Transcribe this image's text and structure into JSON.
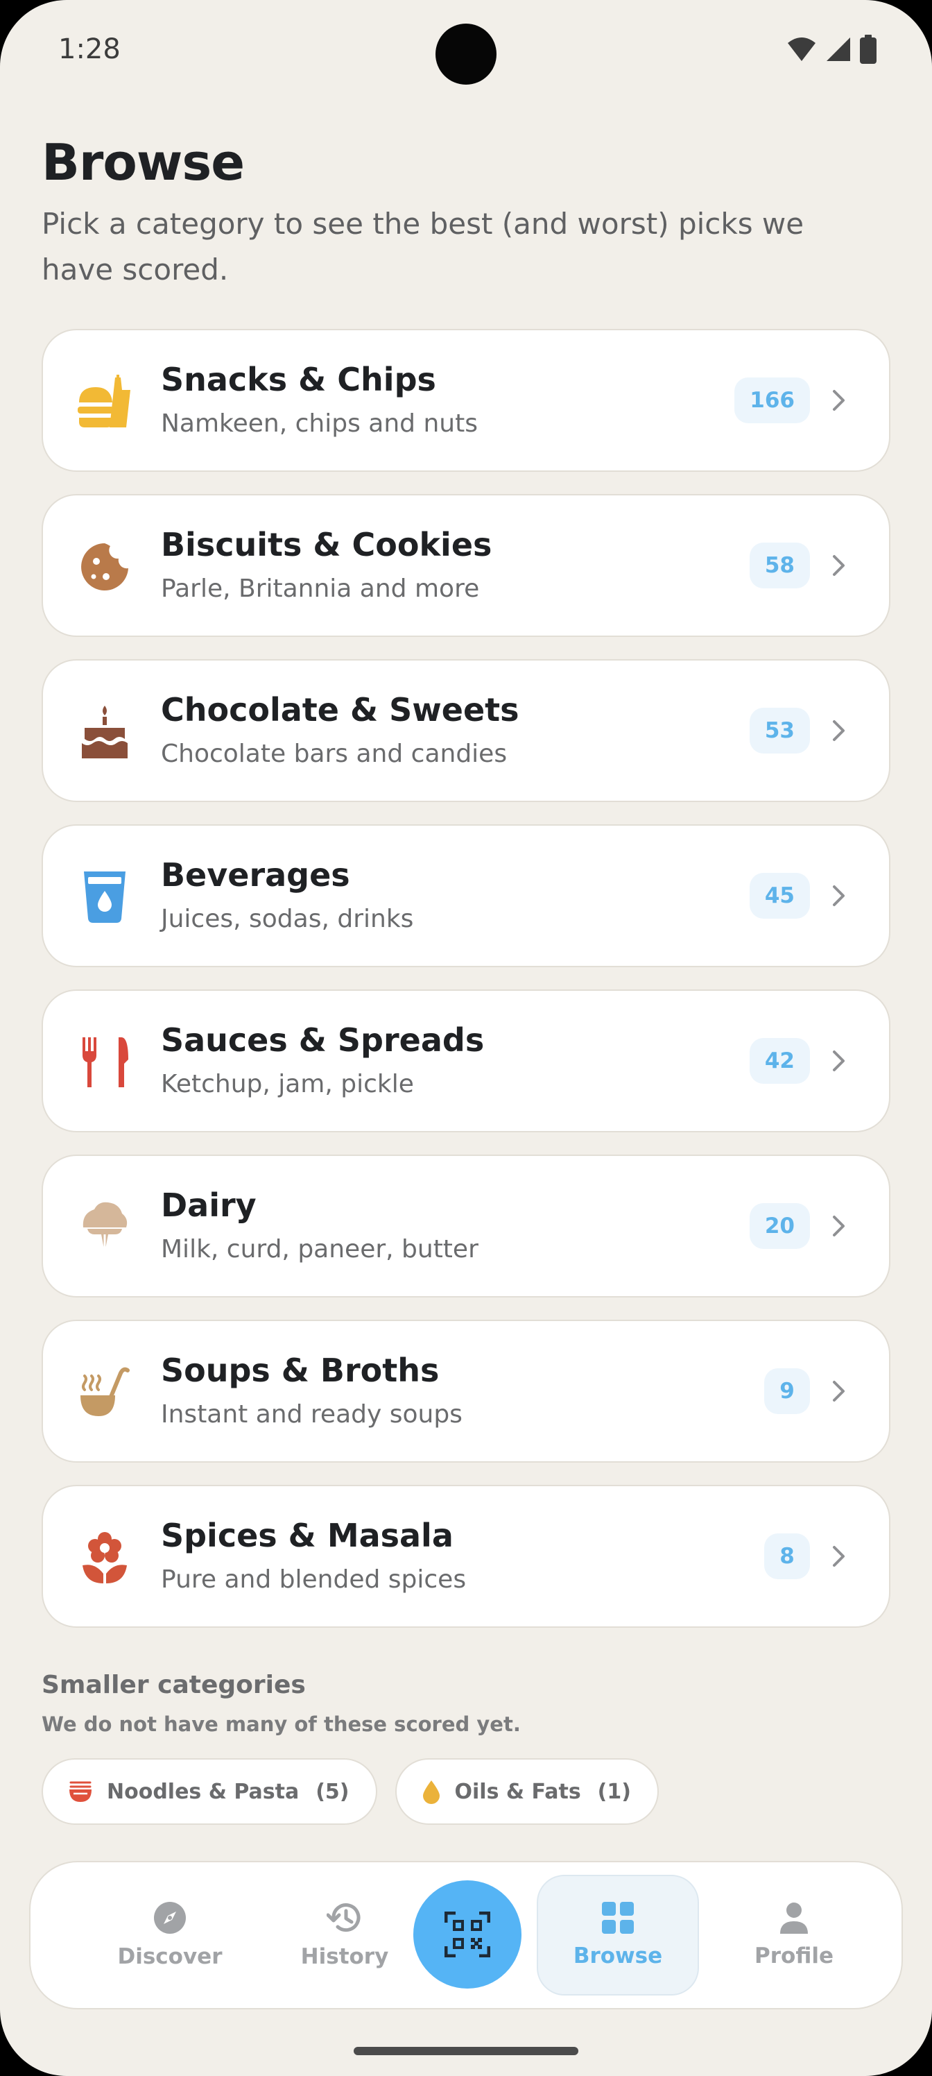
{
  "status_bar": {
    "time": "1:28"
  },
  "header": {
    "title": "Browse",
    "subtitle": "Pick a category to see the best (and worst) picks we have scored."
  },
  "categories": [
    {
      "name": "Snacks & Chips",
      "description": "Namkeen, chips and nuts",
      "count": "166",
      "icon": "burger-fries-icon",
      "color": "#f2b935"
    },
    {
      "name": "Biscuits & Cookies",
      "description": "Parle, Britannia and more",
      "count": "58",
      "icon": "cookie-icon",
      "color": "#b97a4a"
    },
    {
      "name": "Chocolate & Sweets",
      "description": "Chocolate bars and candies",
      "count": "53",
      "icon": "cake-icon",
      "color": "#8a4f3a"
    },
    {
      "name": "Beverages",
      "description": "Juices, sodas, drinks",
      "count": "45",
      "icon": "cup-icon",
      "color": "#4a9ee2"
    },
    {
      "name": "Sauces & Spreads",
      "description": "Ketchup, jam, pickle",
      "count": "42",
      "icon": "cutlery-icon",
      "color": "#d9483c"
    },
    {
      "name": "Dairy",
      "description": "Milk, curd, paneer, butter",
      "count": "20",
      "icon": "ice-cream-icon",
      "color": "#d5b79a"
    },
    {
      "name": "Soups & Broths",
      "description": "Instant and ready soups",
      "count": "9",
      "icon": "ladle-icon",
      "color": "#c49a64"
    },
    {
      "name": "Spices & Masala",
      "description": "Pure and blended spices",
      "count": "8",
      "icon": "flower-icon",
      "color": "#d2553a"
    }
  ],
  "smaller": {
    "title": "Smaller categories",
    "subtitle": "We do not have many of these scored yet.",
    "chips": [
      {
        "label": "Noodles & Pasta",
        "count": "(5)",
        "icon": "noodle-bowl-icon",
        "color": "#e0513c"
      },
      {
        "label": "Oils & Fats",
        "count": "(1)",
        "icon": "oil-drop-icon",
        "color": "#ebb23a"
      }
    ]
  },
  "nav": {
    "items": [
      {
        "label": "Discover",
        "icon": "compass-icon"
      },
      {
        "label": "History",
        "icon": "history-icon"
      },
      {
        "label": "Browse",
        "icon": "grid-icon",
        "active": true
      },
      {
        "label": "Profile",
        "icon": "person-icon"
      }
    ],
    "scan_icon": "qr-scan-icon",
    "accent": "#5db3ea"
  }
}
